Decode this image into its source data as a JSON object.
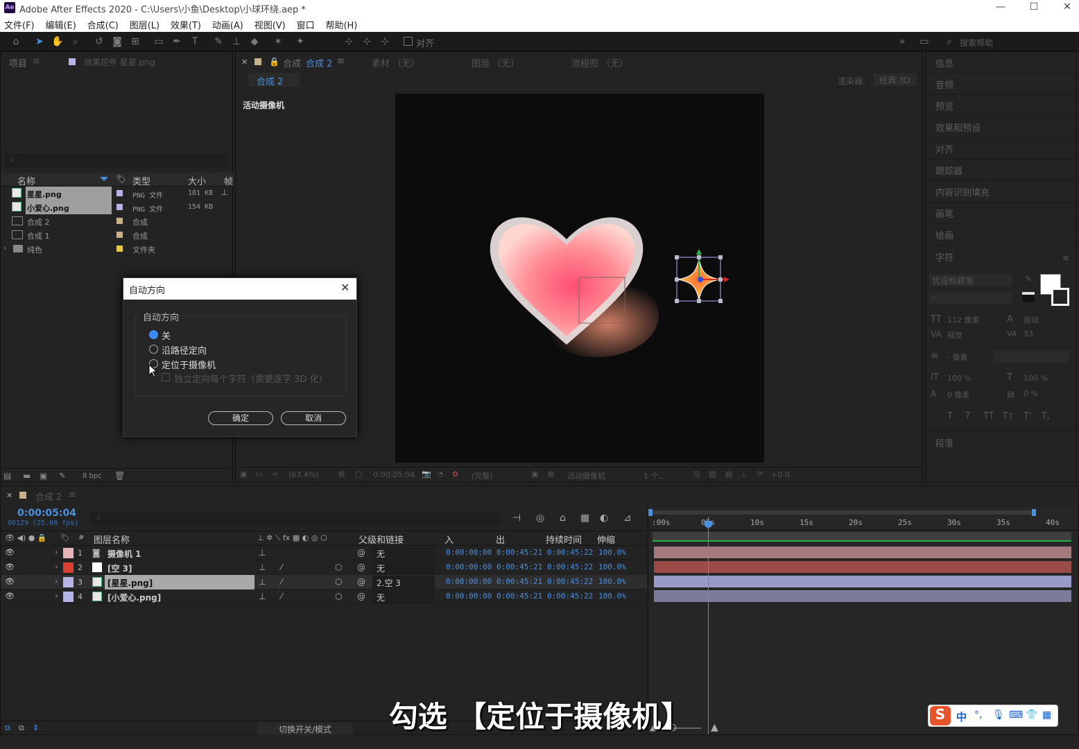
{
  "app": {
    "logo": "Ae",
    "title": "Adobe After Effects 2020 - C:\\Users\\小鱼\\Desktop\\小球环绕.aep *",
    "window_controls": [
      "—",
      "☐",
      "✕"
    ]
  },
  "menu": [
    "文件(F)",
    "编辑(E)",
    "合成(C)",
    "图层(L)",
    "效果(T)",
    "动画(A)",
    "视图(V)",
    "窗口",
    "帮助(H)"
  ],
  "toolbar": {
    "align_label": "对齐",
    "search_placeholder": "搜索帮助"
  },
  "project_panel": {
    "tabs": [
      "项目",
      "效果控件 星星.png"
    ],
    "columns": [
      "名称",
      "类型",
      "大小",
      "帧"
    ],
    "items": [
      {
        "name": "星星.png",
        "type": "PNG 文件",
        "size": "181 KB",
        "color": "#b4b4e6"
      },
      {
        "name": "小爱心.png",
        "type": "PNG 文件",
        "size": "154 KB",
        "color": "#b4b4e6"
      },
      {
        "name": "合成 2",
        "type": "合成",
        "size": "",
        "color": "#c8b28a"
      },
      {
        "name": "合成 1",
        "type": "合成",
        "size": "",
        "color": "#c8b28a"
      },
      {
        "name": "纯色",
        "type": "文件夹",
        "size": "",
        "color": "#e6c84b"
      }
    ],
    "bpc": "8 bpc"
  },
  "comp_panel": {
    "tab_prefix": "合成",
    "tab_name": "合成 2",
    "other_tabs": [
      "素材 （无）",
      "图层 （无）",
      "流程图 （无）"
    ],
    "sub_tab": "合成 2",
    "renderer_label": "渲染器:",
    "renderer_value": "经典 3D",
    "camera_label": "活动摄像机",
    "footer": {
      "zoom": "(63.4%)",
      "time": "0:00:05:04",
      "quality": "(完整)",
      "view": "活动摄像机",
      "views_count": "1 个...",
      "exposure": "+0.0"
    }
  },
  "right_panel": {
    "items": [
      "信息",
      "音频",
      "预览",
      "效果和预设",
      "对齐",
      "跟踪器",
      "内容识别填充",
      "画笔",
      "绘画",
      "字符"
    ],
    "character": {
      "font": "优设标题黑",
      "style": "-",
      "size": "112 像素",
      "leading": "自动",
      "kerning": "视觉",
      "tracking": "33",
      "stroke": "- 像素",
      "vscale": "100 %",
      "hscale": "100 %",
      "baseline": "0 像素",
      "tsume": "0 %",
      "styles": [
        "T",
        "T",
        "TT",
        "Tт",
        "T'",
        "T,"
      ]
    },
    "paragraph": "段落"
  },
  "dialog": {
    "title": "自动方向",
    "group_label": "自动方向",
    "options": [
      "关",
      "沿路径定向",
      "定位于摄像机"
    ],
    "checkbox": "独立定向每个字符（需要逐字 3D 化）",
    "ok": "确定",
    "cancel": "取消"
  },
  "timeline": {
    "tab": "合成 2",
    "current_time": "0:00:05:04",
    "frame_info": "00129 (25.00 fps)",
    "columns": [
      "图层名称",
      "父级和链接",
      "入",
      "出",
      "持续时间",
      "伸缩"
    ],
    "ruler": [
      ":00s",
      "05s",
      "10s",
      "15s",
      "20s",
      "25s",
      "30s",
      "35s",
      "40s"
    ],
    "playhead_seconds": 5.16,
    "layers": [
      {
        "num": "1",
        "name": "摄像机 1",
        "parent": "无",
        "in": "0:00:00:00",
        "out": "0:00:45:21",
        "dur": "0:00:45:22",
        "stretch": "100.0%",
        "color": "#e8b4bc",
        "bar": "#a4797e"
      },
      {
        "num": "2",
        "name": "[空 3]",
        "parent": "无",
        "in": "0:00:00:00",
        "out": "0:00:45:21",
        "dur": "0:00:45:22",
        "stretch": "100.0%",
        "color": "#d9402f",
        "bar": "#9b4c46"
      },
      {
        "num": "3",
        "name": "[星星.png]",
        "parent": "2.空 3",
        "in": "0:00:00:00",
        "out": "0:00:45:21",
        "dur": "0:00:45:22",
        "stretch": "100.0%",
        "color": "#b4b4e6",
        "bar": "#9a9ac8"
      },
      {
        "num": "4",
        "name": "[小爱心.png]",
        "parent": "无",
        "in": "0:00:00:00",
        "out": "0:00:45:21",
        "dur": "0:00:45:22",
        "stretch": "100.0%",
        "color": "#b4b4e6",
        "bar": "#7c7c9a"
      }
    ],
    "footer_toggle": "切换开关/模式"
  },
  "subtitle": "勾选 【定位于摄像机】",
  "ime": {
    "lang": "中",
    "icons": [
      "°,",
      "mic",
      "kbd",
      "shirt",
      "grid"
    ]
  }
}
